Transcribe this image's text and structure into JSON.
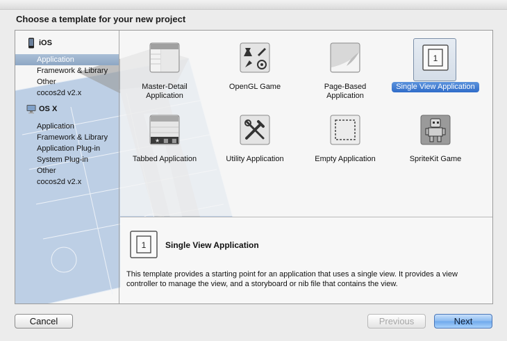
{
  "window": {
    "heading": "Choose a template for your new project"
  },
  "sidebar": {
    "groups": [
      {
        "name": "iOS",
        "icon": "iphone-icon",
        "items": [
          "Application",
          "Framework & Library",
          "Other",
          "cocos2d v2.x"
        ]
      },
      {
        "name": "OS X",
        "icon": "mac-icon",
        "items": [
          "Application",
          "Framework & Library",
          "Application Plug-in",
          "System Plug-in",
          "Other",
          "cocos2d v2.x"
        ]
      }
    ],
    "selected": "iOS / Application"
  },
  "templates": [
    {
      "label": "Master-Detail Application",
      "icon": "master-detail-icon"
    },
    {
      "label": "OpenGL Game",
      "icon": "opengl-game-icon"
    },
    {
      "label": "Page-Based Application",
      "icon": "page-based-icon"
    },
    {
      "label": "Single View Application",
      "icon": "single-view-icon",
      "selected": true
    },
    {
      "label": "Tabbed Application",
      "icon": "tabbed-icon"
    },
    {
      "label": "Utility Application",
      "icon": "utility-icon"
    },
    {
      "label": "Empty Application",
      "icon": "empty-app-icon"
    },
    {
      "label": "SpriteKit Game",
      "icon": "spritekit-icon"
    }
  ],
  "detail": {
    "title": "Single View Application",
    "description": "This template provides a starting point for an application that uses a single view. It provides a view controller to manage the view, and a storyboard or nib file that contains the view."
  },
  "buttons": {
    "cancel": "Cancel",
    "previous": "Previous",
    "next": "Next"
  },
  "colors": {
    "selection_blue": "#2f6cc9",
    "sidebar_selection": "#8ea7c4",
    "blueprint": "#8fb0d8"
  }
}
